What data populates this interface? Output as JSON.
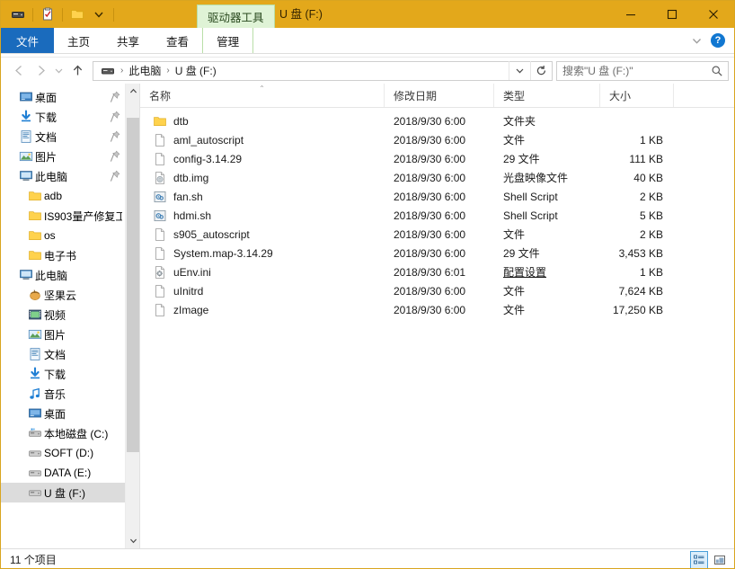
{
  "titlebar": {
    "quick_access": [
      {
        "name": "drive-icon",
        "label": "驱动器"
      },
      {
        "name": "properties-icon",
        "label": "属性"
      },
      {
        "name": "new-folder-icon",
        "label": "新建文件夹"
      },
      {
        "name": "customize-chevron-icon",
        "label": "自定义快速访问工具栏"
      }
    ],
    "contextual_tab": "驱动器工具",
    "title": "U 盘 (F:)",
    "minimize": "最小化",
    "maximize": "最大化",
    "close": "关闭"
  },
  "ribbon": {
    "tabs": [
      {
        "label": "文件",
        "type": "file"
      },
      {
        "label": "主页",
        "type": "normal"
      },
      {
        "label": "共享",
        "type": "normal"
      },
      {
        "label": "查看",
        "type": "normal"
      },
      {
        "label": "管理",
        "type": "contextual"
      }
    ],
    "expand_label": "展开功能区",
    "help_label": "?"
  },
  "addressbar": {
    "back": "后退",
    "forward": "前进",
    "recent": "最近浏览的位置",
    "up": "向上",
    "root_icon": "drive-icon",
    "breadcrumbs": [
      "此电脑",
      "U 盘 (F:)"
    ],
    "separator": "›",
    "dropdown": "历史记录",
    "refresh": "刷新",
    "search_placeholder": "搜索\"U 盘 (F:)\""
  },
  "sidebar": {
    "groups": [
      {
        "name": "quick-access",
        "items": [
          {
            "label": "桌面",
            "icon": "desktop-icon",
            "pinned": true
          },
          {
            "label": "下载",
            "icon": "download-icon",
            "pinned": true
          },
          {
            "label": "文档",
            "icon": "documents-icon",
            "pinned": true
          },
          {
            "label": "图片",
            "icon": "pictures-icon",
            "pinned": true
          },
          {
            "label": "此电脑",
            "icon": "computer-icon",
            "pinned": true
          },
          {
            "label": "adb",
            "icon": "folder-icon",
            "pinned": false
          },
          {
            "label": "IS903量产修复工",
            "icon": "folder-icon",
            "pinned": false
          },
          {
            "label": "os",
            "icon": "folder-icon",
            "pinned": false
          },
          {
            "label": "电子书",
            "icon": "folder-icon",
            "pinned": false
          }
        ]
      },
      {
        "name": "this-pc",
        "items": [
          {
            "label": "此电脑",
            "icon": "computer-icon",
            "pinned": false
          },
          {
            "label": "坚果云",
            "icon": "nutstore-icon",
            "pinned": false
          },
          {
            "label": "视频",
            "icon": "videos-icon",
            "pinned": false
          },
          {
            "label": "图片",
            "icon": "pictures-icon",
            "pinned": false
          },
          {
            "label": "文档",
            "icon": "documents-icon",
            "pinned": false
          },
          {
            "label": "下载",
            "icon": "download-icon",
            "pinned": false
          },
          {
            "label": "音乐",
            "icon": "music-icon",
            "pinned": false
          },
          {
            "label": "桌面",
            "icon": "desktop-icon",
            "pinned": false
          },
          {
            "label": "本地磁盘 (C:)",
            "icon": "system-drive-icon",
            "pinned": false
          },
          {
            "label": "SOFT (D:)",
            "icon": "drive-icon",
            "pinned": false
          },
          {
            "label": "DATA (E:)",
            "icon": "drive-icon",
            "pinned": false
          },
          {
            "label": "U 盘 (F:)",
            "icon": "drive-icon",
            "pinned": false,
            "selected": true
          }
        ]
      }
    ],
    "scroll_up": "向上滚动",
    "scroll_down": "向下滚动"
  },
  "filelist": {
    "columns": [
      {
        "label": "名称",
        "sorted": "asc"
      },
      {
        "label": "修改日期",
        "sorted": ""
      },
      {
        "label": "类型",
        "sorted": ""
      },
      {
        "label": "大小",
        "sorted": ""
      }
    ],
    "sort_indicator": "⌃",
    "rows": [
      {
        "name": "dtb",
        "icon": "folder-icon",
        "date": "2018/9/30 6:00",
        "type": "文件夹",
        "type_link": false,
        "size": ""
      },
      {
        "name": "aml_autoscript",
        "icon": "file-icon",
        "date": "2018/9/30 6:00",
        "type": "文件",
        "type_link": false,
        "size": "1 KB"
      },
      {
        "name": "config-3.14.29",
        "icon": "file-icon",
        "date": "2018/9/30 6:00",
        "type": "29 文件",
        "type_link": false,
        "size": "111 KB"
      },
      {
        "name": "dtb.img",
        "icon": "disc-image-icon",
        "date": "2018/9/30 6:00",
        "type": "光盘映像文件",
        "type_link": false,
        "size": "40 KB"
      },
      {
        "name": "fan.sh",
        "icon": "shell-script-icon",
        "date": "2018/9/30 6:00",
        "type": "Shell Script",
        "type_link": false,
        "size": "2 KB"
      },
      {
        "name": "hdmi.sh",
        "icon": "shell-script-icon",
        "date": "2018/9/30 6:00",
        "type": "Shell Script",
        "type_link": false,
        "size": "5 KB"
      },
      {
        "name": "s905_autoscript",
        "icon": "file-icon",
        "date": "2018/9/30 6:00",
        "type": "文件",
        "type_link": false,
        "size": "2 KB"
      },
      {
        "name": "System.map-3.14.29",
        "icon": "file-icon",
        "date": "2018/9/30 6:00",
        "type": "29 文件",
        "type_link": false,
        "size": "3,453 KB"
      },
      {
        "name": "uEnv.ini",
        "icon": "config-icon",
        "date": "2018/9/30 6:01",
        "type": "配置设置",
        "type_link": true,
        "size": "1 KB"
      },
      {
        "name": "uInitrd",
        "icon": "file-icon",
        "date": "2018/9/30 6:00",
        "type": "文件",
        "type_link": false,
        "size": "7,624 KB"
      },
      {
        "name": "zImage",
        "icon": "file-icon",
        "date": "2018/9/30 6:00",
        "type": "文件",
        "type_link": false,
        "size": "17,250 KB"
      }
    ]
  },
  "statusbar": {
    "item_count": "11 个项目",
    "details_view": "详细信息",
    "tiles_view": "大图标"
  },
  "colors": {
    "titlebar": "#e3a81b",
    "file_tab": "#1a6bbd",
    "contextual_tab": "#dff3d6",
    "selection": "#dcdcdc",
    "folder": "#ffd24d"
  }
}
